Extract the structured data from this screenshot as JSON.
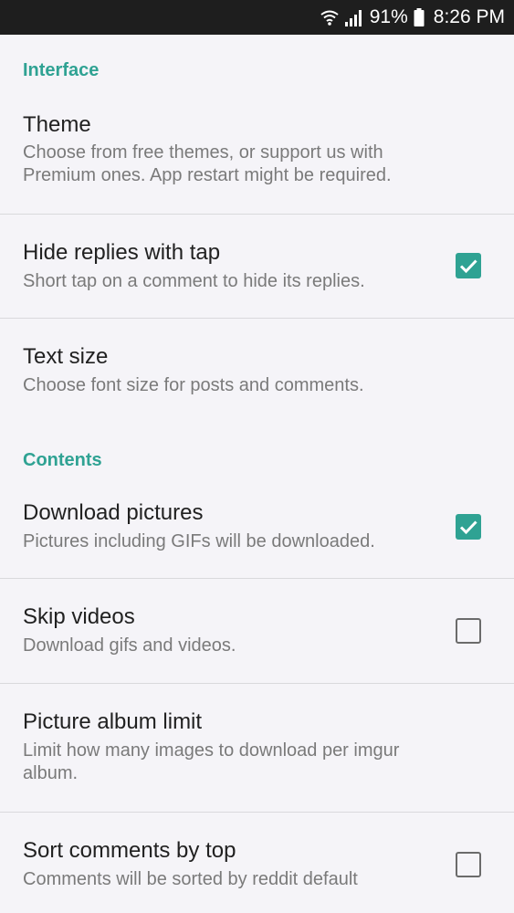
{
  "status_bar": {
    "wifi_icon": "wifi-icon",
    "signal_icon": "signal-icon",
    "battery_percent": "91%",
    "battery_icon": "battery-icon",
    "time": "8:26 PM"
  },
  "colors": {
    "accent": "#2fa293",
    "background": "#f5f4f8",
    "status_bar": "#1e1e1e"
  },
  "sections": {
    "interface": {
      "header": "Interface",
      "theme": {
        "title": "Theme",
        "summary": "Choose from free themes, or support us with Premium ones. App restart might be required."
      },
      "hide_replies": {
        "title": "Hide replies with tap",
        "summary": "Short tap on a comment to hide its replies.",
        "checked": true
      },
      "text_size": {
        "title": "Text size",
        "summary": "Choose font size for posts and comments."
      }
    },
    "contents": {
      "header": "Contents",
      "download_pictures": {
        "title": "Download pictures",
        "summary": "Pictures including GIFs will be downloaded.",
        "checked": true
      },
      "skip_videos": {
        "title": "Skip videos",
        "summary": "Download gifs and videos.",
        "checked": false
      },
      "album_limit": {
        "title": "Picture album limit",
        "summary": "Limit how many images to download per imgur album."
      },
      "sort_comments": {
        "title": "Sort comments by top",
        "summary": "Comments will be sorted by reddit default",
        "checked": false
      }
    }
  }
}
